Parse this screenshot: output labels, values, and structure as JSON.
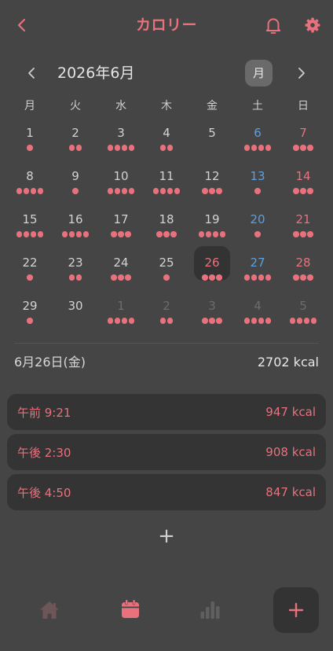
{
  "header": {
    "title": "カロリー",
    "back_icon": "chevron-left-icon",
    "notification_icon": "bell-icon",
    "settings_icon": "gear-icon"
  },
  "calendar": {
    "month_label": "2026年6月",
    "view_toggle_label": "月",
    "prev_icon": "chevron-left-icon",
    "next_icon": "chevron-right-icon",
    "weekdays": [
      "月",
      "火",
      "水",
      "木",
      "金",
      "土",
      "日"
    ],
    "weeks": [
      [
        {
          "day": "1",
          "dots": 1
        },
        {
          "day": "2",
          "dots": 2
        },
        {
          "day": "3",
          "dots": 4
        },
        {
          "day": "4",
          "dots": 2
        },
        {
          "day": "5",
          "dots": 0
        },
        {
          "day": "6",
          "dots": 4
        },
        {
          "day": "7",
          "dots": 3
        }
      ],
      [
        {
          "day": "8",
          "dots": 4
        },
        {
          "day": "9",
          "dots": 1
        },
        {
          "day": "10",
          "dots": 4
        },
        {
          "day": "11",
          "dots": 4
        },
        {
          "day": "12",
          "dots": 3
        },
        {
          "day": "13",
          "dots": 1
        },
        {
          "day": "14",
          "dots": 3
        }
      ],
      [
        {
          "day": "15",
          "dots": 4
        },
        {
          "day": "16",
          "dots": 4
        },
        {
          "day": "17",
          "dots": 3
        },
        {
          "day": "18",
          "dots": 3
        },
        {
          "day": "19",
          "dots": 4
        },
        {
          "day": "20",
          "dots": 1
        },
        {
          "day": "21",
          "dots": 3
        }
      ],
      [
        {
          "day": "22",
          "dots": 1
        },
        {
          "day": "23",
          "dots": 2
        },
        {
          "day": "24",
          "dots": 3
        },
        {
          "day": "25",
          "dots": 1
        },
        {
          "day": "26",
          "dots": 3,
          "selected": true
        },
        {
          "day": "27",
          "dots": 4
        },
        {
          "day": "28",
          "dots": 3
        }
      ],
      [
        {
          "day": "29",
          "dots": 1
        },
        {
          "day": "30",
          "dots": 0
        },
        {
          "day": "1",
          "dots": 4,
          "other_month": true
        },
        {
          "day": "2",
          "dots": 2,
          "other_month": true
        },
        {
          "day": "3",
          "dots": 3,
          "other_month": true
        },
        {
          "day": "4",
          "dots": 4,
          "other_month": true
        },
        {
          "day": "5",
          "dots": 4,
          "other_month": true
        }
      ]
    ]
  },
  "summary": {
    "date": "6月26日(金)",
    "total": "2702 kcal"
  },
  "entries": [
    {
      "time": "午前 9:21",
      "kcal": "947 kcal"
    },
    {
      "time": "午後 2:30",
      "kcal": "908 kcal"
    },
    {
      "time": "午後 4:50",
      "kcal": "847 kcal"
    }
  ],
  "add_entry_label": "+",
  "bottom_nav": {
    "items": [
      {
        "icon": "home-icon",
        "active": false
      },
      {
        "icon": "calendar-icon",
        "active": true
      },
      {
        "icon": "bar-chart-icon",
        "active": false
      }
    ],
    "add_button_icon": "plus-icon"
  },
  "colors": {
    "accent": "#e8717d",
    "saturday": "#5b9fe0",
    "sunday": "#e8717d",
    "day_number": "#d2d2d2",
    "other_month": "#6c6c6c",
    "background": "#454545",
    "card": "#343434"
  }
}
